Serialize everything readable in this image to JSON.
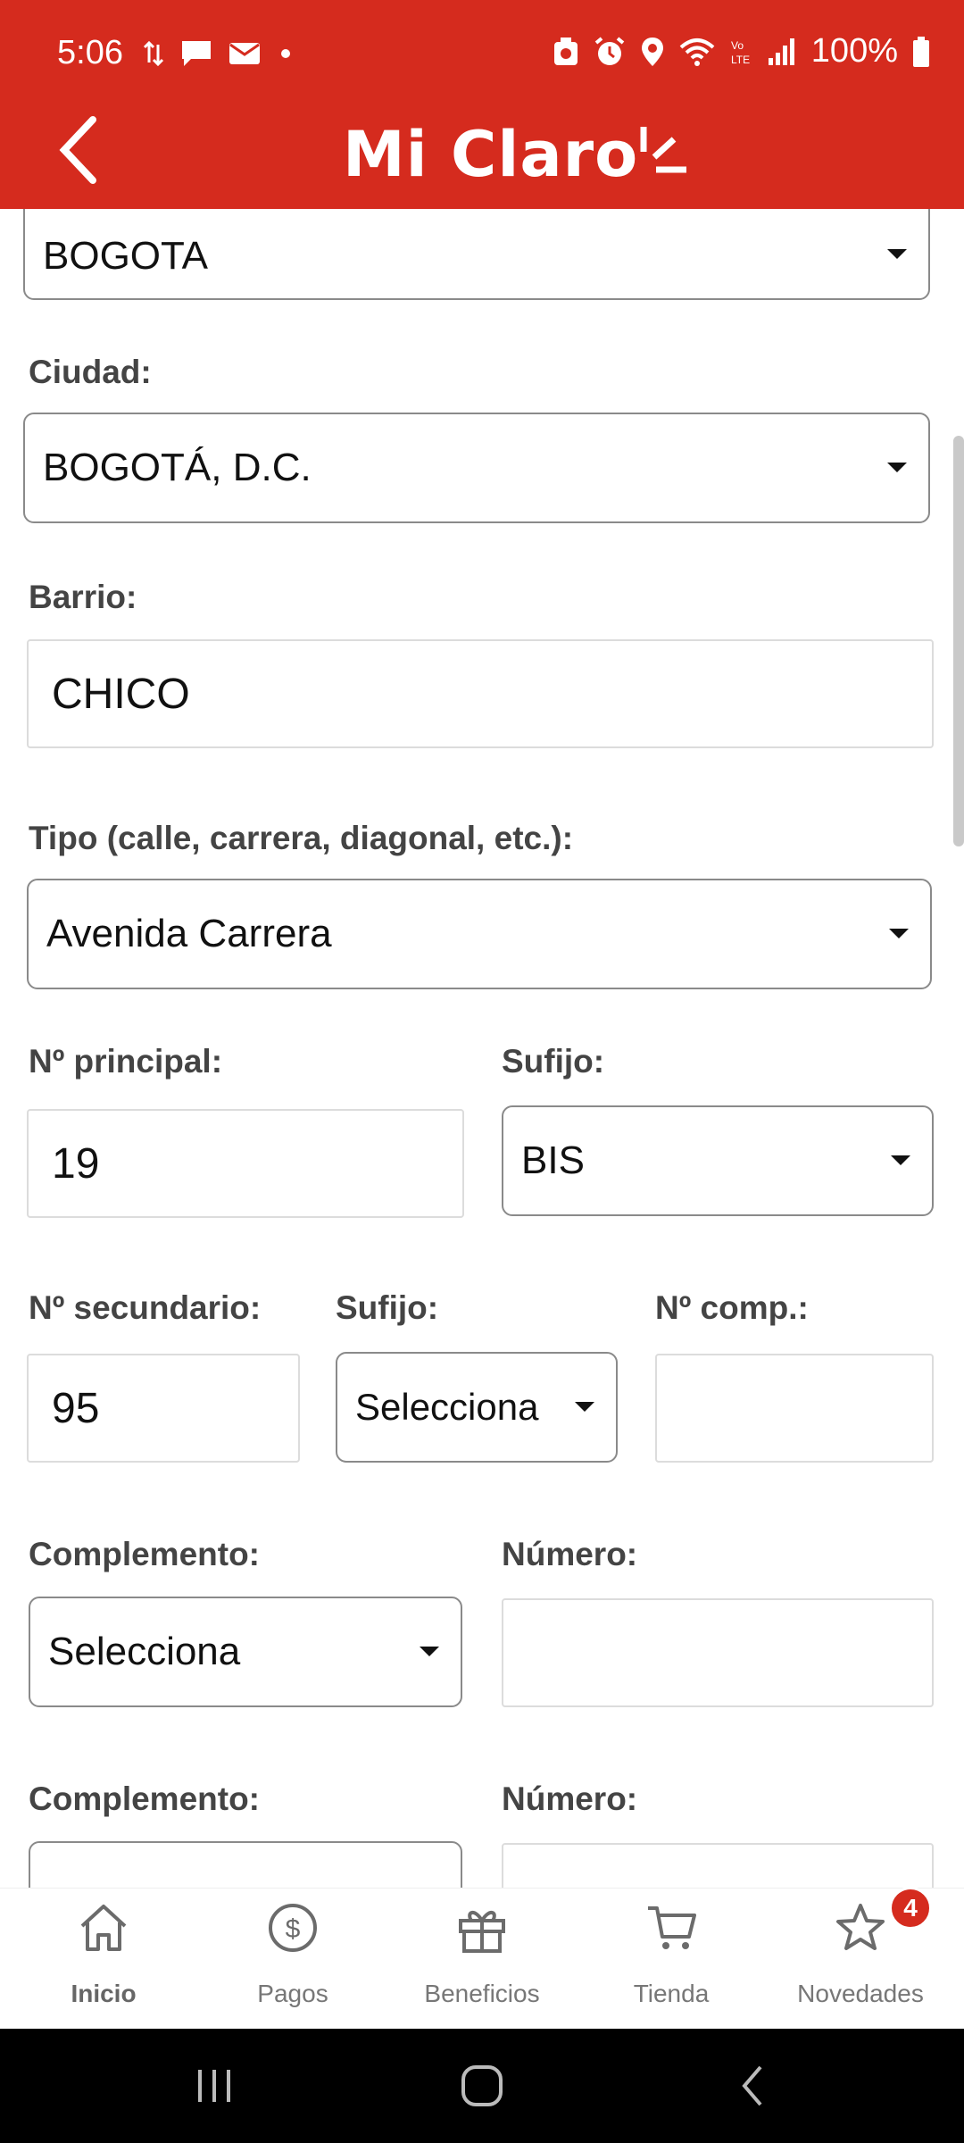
{
  "status_bar": {
    "time": "5:06",
    "battery": "100%"
  },
  "header": {
    "brand": "Mi Claro"
  },
  "form": {
    "departamento_value": "BOGOTA",
    "ciudad_label": "Ciudad:",
    "ciudad_value": "BOGOTÁ, D.C.",
    "barrio_label": "Barrio:",
    "barrio_value": "CHICO",
    "tipo_label": "Tipo (calle, carrera, diagonal, etc.):",
    "tipo_value": "Avenida Carrera",
    "n_principal_label": "Nº principal:",
    "n_principal_value": "19",
    "sufijo1_label": "Sufijo:",
    "sufijo1_value": "BIS",
    "n_secundario_label": "Nº secundario:",
    "n_secundario_value": "95",
    "sufijo2_label": "Sufijo:",
    "sufijo2_value": "Selecciona",
    "n_comp_label": "Nº comp.:",
    "n_comp_value": "",
    "complemento1_label": "Complemento:",
    "complemento1_value": "Selecciona",
    "numero1_label": "Número:",
    "numero1_value": "",
    "complemento2_label": "Complemento:",
    "numero2_label": "Número:"
  },
  "tabbar": {
    "tabs": [
      {
        "label": "Inicio",
        "icon": "home-icon"
      },
      {
        "label": "Pagos",
        "icon": "dollar-icon"
      },
      {
        "label": "Beneficios",
        "icon": "gift-icon"
      },
      {
        "label": "Tienda",
        "icon": "cart-icon"
      },
      {
        "label": "Novedades",
        "icon": "star-icon"
      }
    ],
    "novedades_badge": "4"
  },
  "colors": {
    "brand_red": "#d52b1e"
  }
}
